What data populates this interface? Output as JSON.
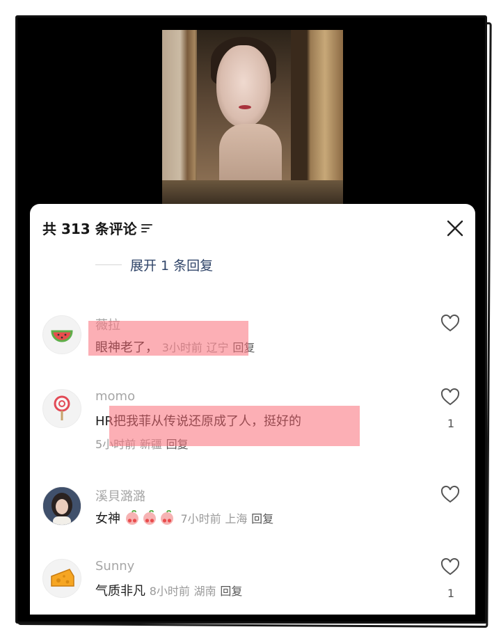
{
  "header": {
    "title": "共 313 条评论",
    "expand_replies": "展开 1 条回复"
  },
  "comments": [
    {
      "username": "薇拉",
      "text": "眼神老了，",
      "time": "3小时前",
      "location": "辽宁",
      "reply_label": "回复",
      "likes": "",
      "avatar_icon": "watermelon-icon"
    },
    {
      "username": "momo",
      "text": "HR把我菲从传说还原成了人，挺好的",
      "time": "5小时前",
      "location": "新疆",
      "reply_label": "回复",
      "likes": "1",
      "avatar_icon": "lollipop-icon"
    },
    {
      "username": "溪貝潞潞",
      "text": "女神",
      "time": "7小时前",
      "location": "上海",
      "reply_label": "回复",
      "likes": "",
      "avatar_icon": "photo-avatar"
    },
    {
      "username": "Sunny",
      "text": "气质非凡",
      "time": "8小时前",
      "location": "湖南",
      "reply_label": "回复",
      "likes": "1",
      "avatar_icon": "cheese-icon"
    }
  ],
  "colors": {
    "highlight": "#fa6e78",
    "link": "#2f4468",
    "muted": "#9a9a9a"
  }
}
